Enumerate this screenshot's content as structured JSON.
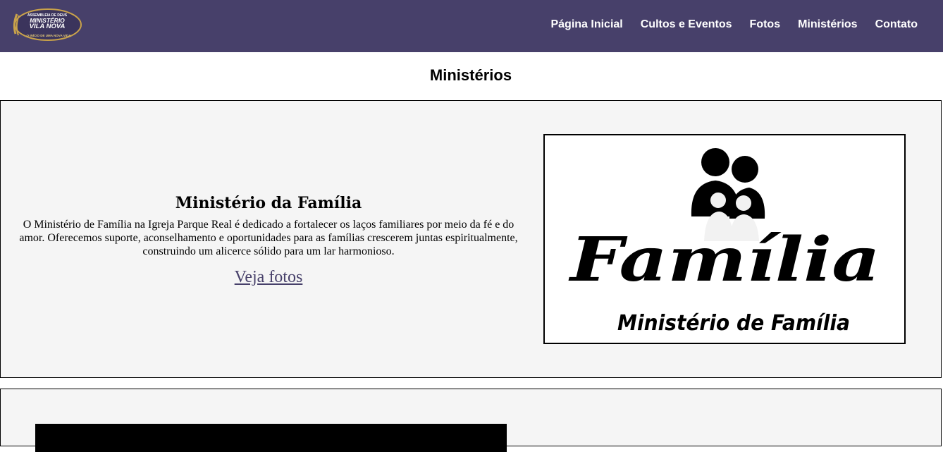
{
  "brand": {
    "logo_lines": [
      "ASSEMBLEIA DE DEUS",
      "MINISTÉRIO",
      "VILA NOVA",
      "O INÍCIO DE UMA NOVA VIDA"
    ],
    "colors": {
      "nav_background": "#47406a",
      "logo_gold": "#c9a24a",
      "link": "#47406a"
    }
  },
  "nav": {
    "items": [
      {
        "label": "Página Inicial"
      },
      {
        "label": "Cultos e Eventos"
      },
      {
        "label": "Fotos"
      },
      {
        "label": "Ministérios"
      },
      {
        "label": "Contato"
      }
    ]
  },
  "page": {
    "title": "Ministérios"
  },
  "ministries": [
    {
      "heading": "Ministério da Família",
      "description": "O Ministério de Família na Igreja Parque Real é dedicado a fortalecer os laços familiares por meio da fé e do amor. Oferecemos suporte, aconselhamento e oportunidades para as famílias crescerem juntas espiritualmente, construindo um alicerce sólido para um lar harmonioso.",
      "link_label": "Veja fotos",
      "image_text": {
        "main": "Família",
        "sub": "Ministério de Família"
      }
    }
  ]
}
